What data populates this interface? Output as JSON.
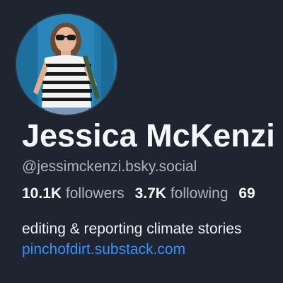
{
  "profile": {
    "display_name": "Jessica McKenzi",
    "handle": "@jessimckenzi.bsky.social",
    "followers_count": "10.1K",
    "followers_label": "followers",
    "following_count": "3.7K",
    "following_label": "following",
    "posts_count_partial": "69",
    "bio": "editing & reporting climate stories",
    "link": "pinchofdirt.substack.com"
  },
  "colors": {
    "background": "#1e2531",
    "text_primary": "#f5f7fa",
    "text_secondary": "#aab4c3",
    "link": "#3b8ff5"
  },
  "icons": {
    "avatar": "profile-photo"
  }
}
